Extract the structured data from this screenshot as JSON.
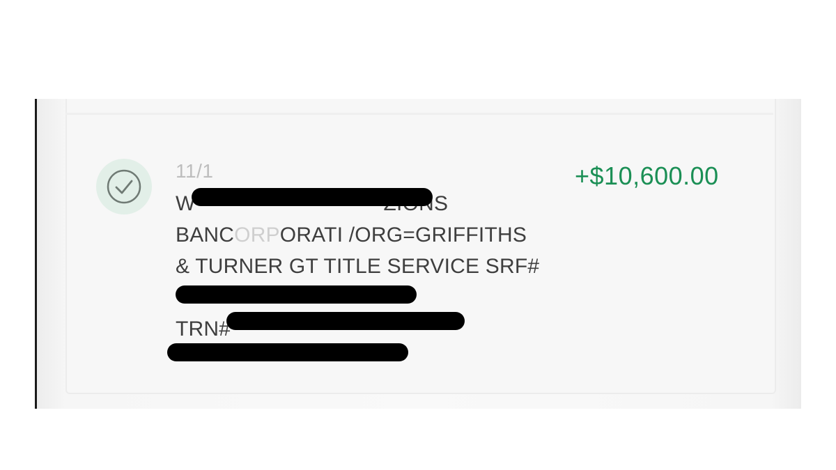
{
  "transaction": {
    "status_icon": "check-circle-icon",
    "date": "11/1",
    "description_lines": {
      "line1": "W",
      "line1_tail": "ZIONS",
      "line2_a": "BANC",
      "line2_faded": "ORP",
      "line2_b": "ORATI /ORG=GRIFFITHS",
      "line3": "& TURNER GT TITLE SERVICE SRF#",
      "line5": "TRN#"
    },
    "amount": "+$10,600.00"
  },
  "colors": {
    "amount": "#1b8f55",
    "status_circle_bg": "#e2efe8",
    "checkmark": "#6f7a74"
  }
}
